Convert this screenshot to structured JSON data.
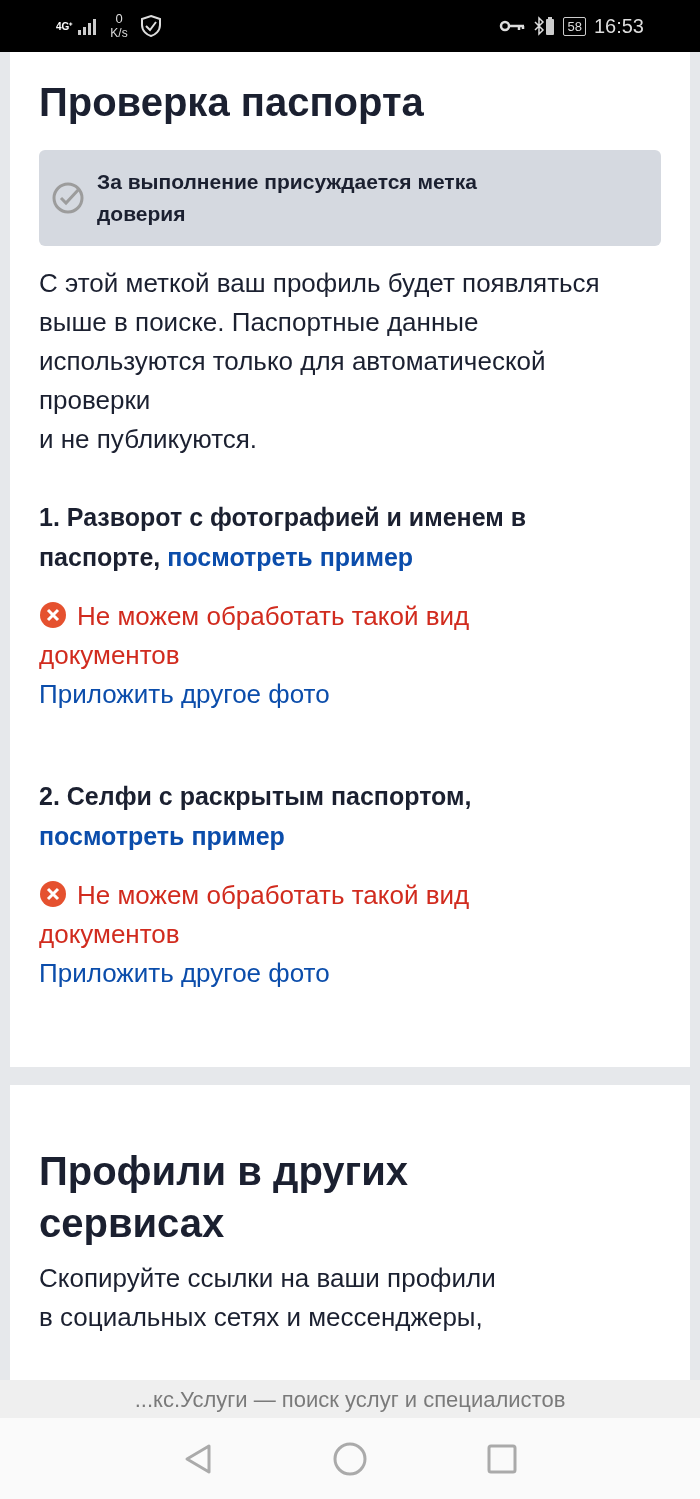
{
  "status_bar": {
    "network": "4G⁺",
    "speed_value": "0",
    "speed_unit": "K/s",
    "battery": "58",
    "time": "16:53"
  },
  "passport_check": {
    "title": "Проверка паспорта",
    "notice": "За выполнение присуждается метка доверия",
    "description_lines": [
      "С этой меткой ваш профиль будет появляться выше в поиске. Паспортные данные используются только для автоматической проверки",
      "и не публикуются."
    ],
    "steps": [
      {
        "title": "1. Разворот с фотографией и именем в паспорте,",
        "link": "посмотреть пример",
        "error": "Не можем обработать такой вид документов",
        "retry": "Приложить другое фото"
      },
      {
        "title": "2. Селфи с раскрытым паспортом,",
        "link": "посмотреть пример",
        "error": "Не можем обработать такой вид документов",
        "retry": "Приложить другое фото"
      }
    ]
  },
  "other_profiles": {
    "title": "Профили в других сервисах",
    "description_lines": [
      "Скопируйте ссылки на ваши профили",
      "в социальных сетях и мессенджеры,"
    ]
  },
  "page_title_bar": "...кс.Услуги — поиск услуг и специалистов"
}
